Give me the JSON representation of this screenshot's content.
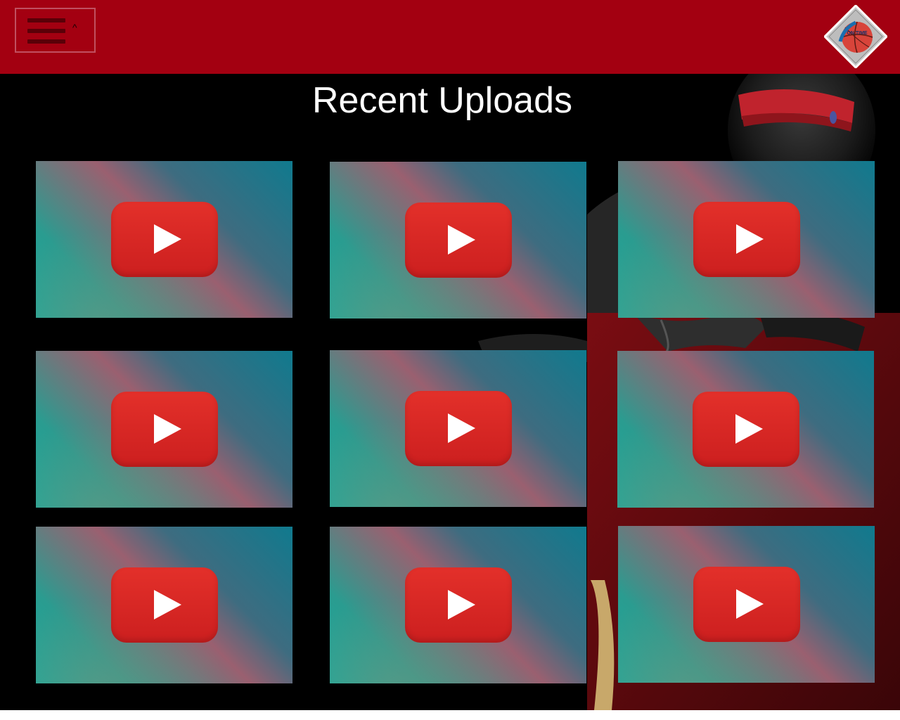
{
  "header": {
    "background_color": "#a30011",
    "menu_icon": "hamburger-icon",
    "menu_caret": "^",
    "logo_icon": "basketball-logo-icon",
    "logo_text": "ON TIME"
  },
  "main": {
    "title": "Recent Uploads"
  },
  "videos": [
    {
      "icon": "youtube-play-icon"
    },
    {
      "icon": "youtube-play-icon"
    },
    {
      "icon": "youtube-play-icon"
    },
    {
      "icon": "youtube-play-icon"
    },
    {
      "icon": "youtube-play-icon"
    },
    {
      "icon": "youtube-play-icon"
    },
    {
      "icon": "youtube-play-icon"
    },
    {
      "icon": "youtube-play-icon"
    },
    {
      "icon": "youtube-play-icon"
    }
  ],
  "colors": {
    "accent_red": "#a30011",
    "play_red": "#e3302a",
    "page_background": "#000000"
  }
}
